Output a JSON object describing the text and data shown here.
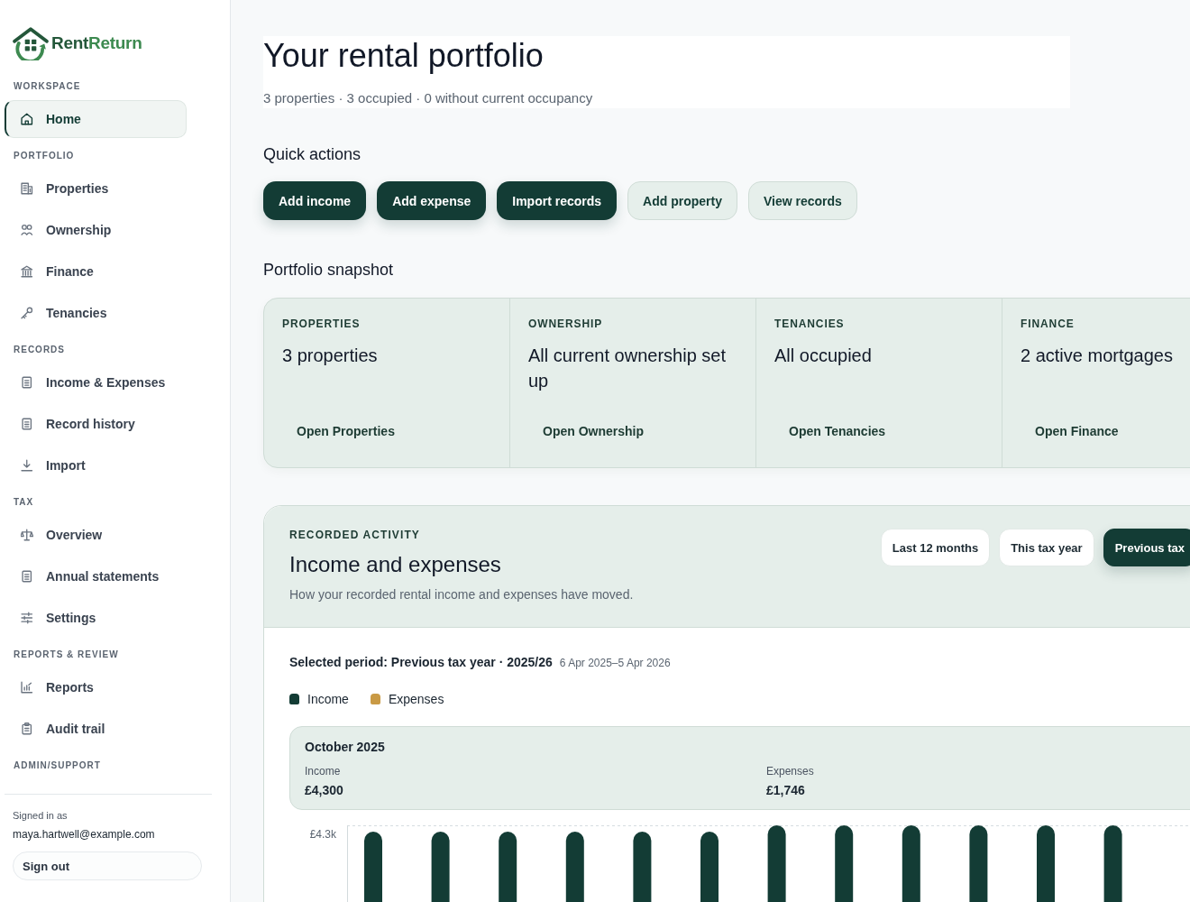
{
  "brand": {
    "name_start": "Rent",
    "name_end": "Return"
  },
  "sidebar": {
    "sections": [
      {
        "label": "WORKSPACE",
        "items": [
          {
            "label": "Home",
            "selected": true
          }
        ]
      },
      {
        "label": "PORTFOLIO",
        "items": [
          {
            "label": "Properties",
            "selected": false
          },
          {
            "label": "Ownership",
            "selected": false
          },
          {
            "label": "Finance",
            "selected": false
          },
          {
            "label": "Tenancies",
            "selected": false
          }
        ]
      },
      {
        "label": "RECORDS",
        "items": [
          {
            "label": "Income & Expenses",
            "selected": false
          },
          {
            "label": "Record history",
            "selected": false
          },
          {
            "label": "Import",
            "selected": false
          }
        ]
      },
      {
        "label": "TAX",
        "items": [
          {
            "label": "Overview",
            "selected": false
          },
          {
            "label": "Annual statements",
            "selected": false
          },
          {
            "label": "Settings",
            "selected": false
          }
        ]
      },
      {
        "label": "REPORTS & REVIEW",
        "items": [
          {
            "label": "Reports",
            "selected": false
          },
          {
            "label": "Audit trail",
            "selected": false
          }
        ]
      },
      {
        "label": "ADMIN/SUPPORT"
      }
    ],
    "signed_in_label": "Signed in as",
    "email": "maya.hartwell@example.com",
    "sign_out": "Sign out"
  },
  "header": {
    "title": "Your rental portfolio",
    "subtitle": "3 properties · 3 occupied · 0 without current occupancy"
  },
  "quick_actions": {
    "heading": "Quick actions",
    "buttons": [
      {
        "label": "Add income",
        "kind": "primary"
      },
      {
        "label": "Add expense",
        "kind": "primary"
      },
      {
        "label": "Import records",
        "kind": "primary"
      },
      {
        "label": "Add property",
        "kind": "secondary"
      },
      {
        "label": "View records",
        "kind": "secondary"
      }
    ]
  },
  "snapshot": {
    "heading": "Portfolio snapshot",
    "cards": [
      {
        "label": "PROPERTIES",
        "value": "3 properties",
        "link": "Open Properties"
      },
      {
        "label": "OWNERSHIP",
        "value": "All current ownership set up",
        "link": "Open Ownership"
      },
      {
        "label": "TENANCIES",
        "value": "All occupied",
        "link": "Open Tenancies"
      },
      {
        "label": "FINANCE",
        "value": "2 active mortgages",
        "link": "Open Finance"
      }
    ]
  },
  "activity": {
    "eyebrow": "RECORDED ACTIVITY",
    "title": "Income and expenses",
    "description": "How your recorded rental income and expenses have moved.",
    "periods": [
      {
        "label": "Last 12 months",
        "selected": false
      },
      {
        "label": "This tax year",
        "selected": false
      },
      {
        "label": "Previous tax",
        "selected": true
      }
    ],
    "selected_period": {
      "label": "Selected period: Previous tax year · 2025/26",
      "range": "6 Apr 2025–5 Apr 2026"
    },
    "legend": [
      {
        "label": "Income",
        "color": "#133c35"
      },
      {
        "label": "Expenses",
        "color": "#c99a45"
      }
    ],
    "summary": {
      "month": "October 2025",
      "figures": [
        {
          "label": "Income",
          "value": "£4,300"
        },
        {
          "label": "Expenses",
          "value": "£1,746"
        }
      ]
    },
    "chart": {
      "y_tick": "£4.3k"
    }
  }
}
